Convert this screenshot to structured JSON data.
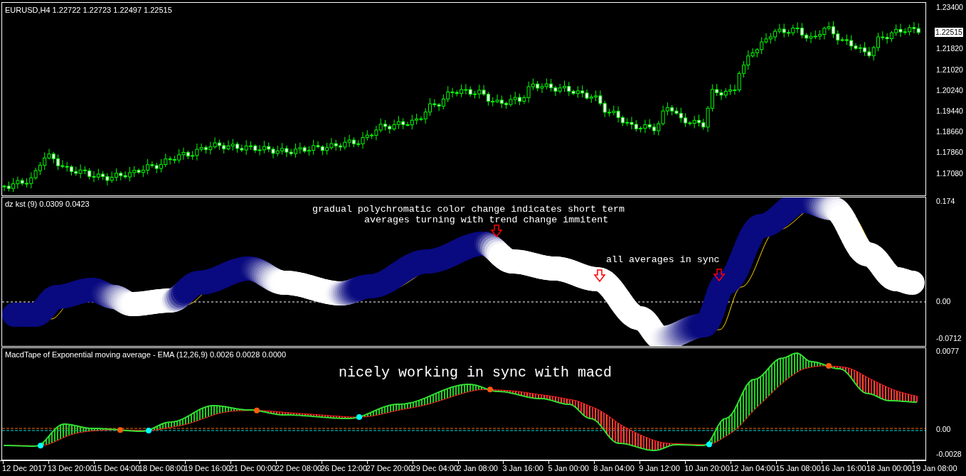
{
  "main_chart": {
    "title": "EURUSD,H4  1.22722 1.22723 1.22497 1.22515"
  },
  "price_axis": {
    "labels": [
      "1.23400",
      "1.21820",
      "1.21020",
      "1.20240",
      "1.19440",
      "1.18660",
      "1.17860",
      "1.17080"
    ],
    "current_price": "1.22515"
  },
  "kst_panel": {
    "title": "dz kst (9) 0.0309 0.0423",
    "axis_labels": [
      "0.174",
      "0.00",
      "-0.0712"
    ],
    "annotations": [
      "gradual polychromatic color change indicates short term",
      "averages turning with trend change immitent",
      "all averages in sync"
    ]
  },
  "macd_panel": {
    "title": "MacdTape of Exponential moving average - EMA (12,26,9) 0.0026 0.0028 0.0000",
    "axis_labels": [
      "0.0077",
      "0.00",
      "-0.0028"
    ],
    "annotations": [
      "nicely working in sync with macd"
    ]
  },
  "time_axis": {
    "labels": [
      "12 Dec 2017",
      "13 Dec 20:00",
      "15 Dec 04:00",
      "18 Dec 08:00",
      "19 Dec 16:00",
      "21 Dec 00:00",
      "22 Dec 08:00",
      "26 Dec 12:00",
      "27 Dec 20:00",
      "29 Dec 04:00",
      "2 Jan 08:00",
      "3 Jan 16:00",
      "5 Jan 00:00",
      "8 Jan 04:00",
      "9 Jan 12:00",
      "10 Jan 20:00",
      "12 Jan 04:00",
      "15 Jan 08:00",
      "16 Jan 16:00",
      "18 Jan 00:00",
      "19 Jan 08:00"
    ]
  }
}
